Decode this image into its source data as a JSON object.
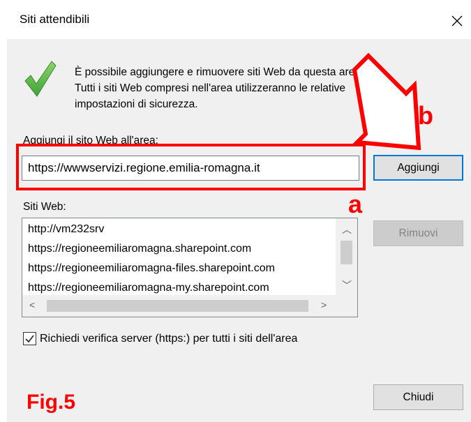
{
  "window": {
    "title": "Siti attendibili",
    "close_glyph": "✕"
  },
  "info": {
    "icon": "checkmark-icon",
    "lines": [
      "È possibile aggiungere e rimuovere siti Web da questa area.",
      "Tutti i siti Web compresi nell'area utilizzeranno le relative",
      "impostazioni di sicurezza."
    ]
  },
  "add_site": {
    "label": "Aggiungi il sito Web all'area:",
    "input_value": "https://wwwservizi.regione.emilia-romagna.it",
    "add_button": "Aggiungi"
  },
  "sites": {
    "label": "Siti Web:",
    "items": [
      "http://vm232srv",
      "https://regioneemiliaromagna.sharepoint.com",
      "https://regioneemiliaromagna-files.sharepoint.com",
      "https://regioneemiliaromagna-my.sharepoint.com"
    ],
    "remove_button": "Rimuovi"
  },
  "require_https": {
    "checked": true,
    "label": "Richiedi verifica server (https:) per tutti i siti dell'area"
  },
  "footer": {
    "close_button": "Chiudi"
  },
  "annotations": {
    "color": "#ff0000",
    "label_a": "a",
    "label_b": "b",
    "figure_label": "Fig.5"
  }
}
